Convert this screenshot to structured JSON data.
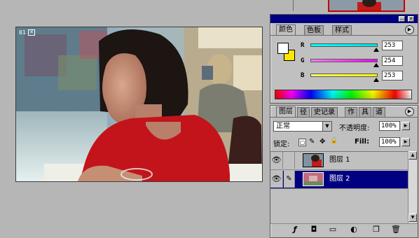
{
  "document": {
    "label": "01",
    "close_glyph": "✕"
  },
  "color_palette": {
    "tabs": [
      "颜色",
      "色板",
      "样式"
    ],
    "title_buttons": [
      "—",
      "✕"
    ],
    "menu_glyph": "▶",
    "fg_color": "#ffffff",
    "bg_color": "#ffe600",
    "sliders": [
      {
        "label": "R",
        "value": "253",
        "gradient": "#00e0e0"
      },
      {
        "label": "G",
        "value": "254",
        "gradient": "#ff00ff"
      },
      {
        "label": "B",
        "value": "253",
        "gradient": "#ffff00"
      }
    ]
  },
  "layers_palette": {
    "tabs": [
      "图层",
      "径",
      "史记录",
      "作",
      "具",
      "道"
    ],
    "menu_glyph": "▶",
    "blend_mode": "正常",
    "opacity_label": "不透明度:",
    "opacity_value": "100%",
    "lock_label": "锁定:",
    "lock_icons": [
      "▢",
      "✎",
      "✥",
      "🔒"
    ],
    "fill_label": "Fill:",
    "fill_value": "100%",
    "layers": [
      {
        "name": "图层 1",
        "selected": false,
        "link": ""
      },
      {
        "name": "图层 2",
        "selected": true,
        "link": "✎"
      }
    ],
    "bottom_icons": [
      "ƒ",
      "◘",
      "▭",
      "◐",
      "❐",
      "🗑"
    ],
    "scroll_up": "▲",
    "scroll_down": "▼"
  },
  "colors": {
    "titlebar": "#000080",
    "selection": "#000080",
    "navigator_border": "#c40000"
  }
}
